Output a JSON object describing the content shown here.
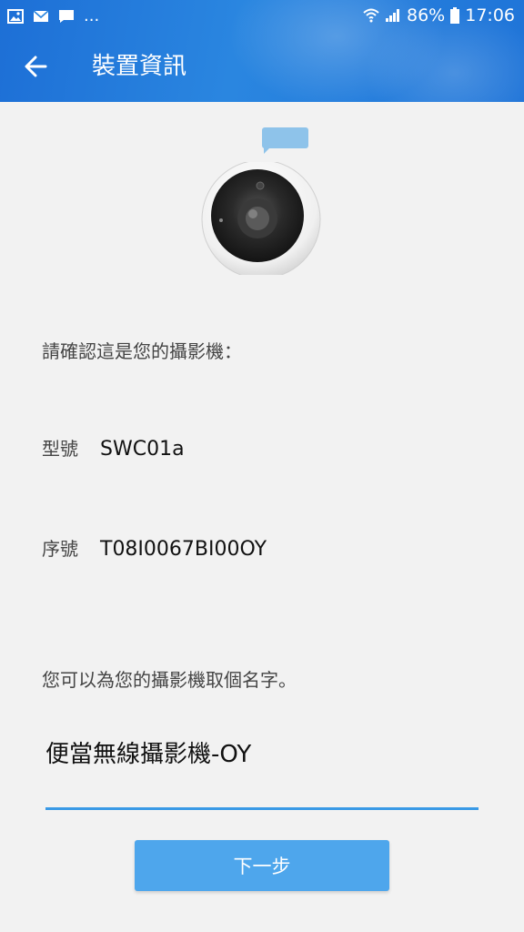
{
  "status_bar": {
    "left_icons": [
      "image-icon",
      "mail-icon",
      "message-icon"
    ],
    "more_indicator": "...",
    "battery_percent": "86%",
    "time": "17:06"
  },
  "toolbar": {
    "title": "裝置資訊"
  },
  "content": {
    "confirm_prompt": "請確認這是您的攝影機：",
    "model_label": "型號",
    "model_value": "SWC01a",
    "serial_label": "序號",
    "serial_value": "T08I0067BI00OY",
    "name_prompt": "您可以為您的攝影機取個名字。",
    "name_value": "便當無線攝影機-OY"
  },
  "actions": {
    "next_label": "下一步"
  },
  "colors": {
    "header": "#2a86e0",
    "accent": "#3a9ae6",
    "button": "#4ea6ec",
    "background": "#f2f2f2"
  }
}
